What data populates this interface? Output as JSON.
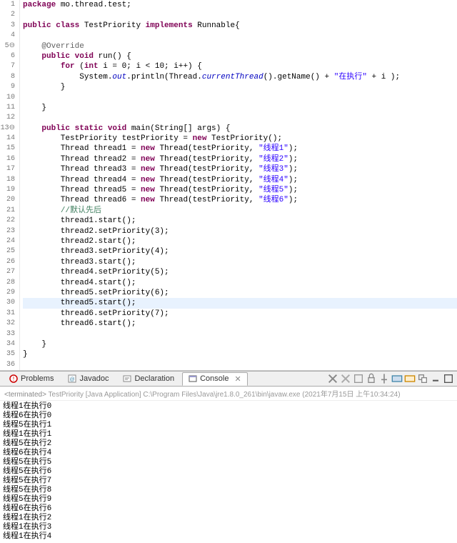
{
  "code": {
    "lines": [
      {
        "n": "1",
        "segs": [
          {
            "t": "package ",
            "c": "kw"
          },
          {
            "t": "mo.thread.test;"
          }
        ]
      },
      {
        "n": "2",
        "segs": []
      },
      {
        "n": "3",
        "segs": [
          {
            "t": "public class ",
            "c": "kw"
          },
          {
            "t": "TestPriority "
          },
          {
            "t": "implements ",
            "c": "kw"
          },
          {
            "t": "Runnable{"
          }
        ]
      },
      {
        "n": "4",
        "segs": []
      },
      {
        "n": "5⊖",
        "segs": [
          {
            "t": "    @Override",
            "c": "ann"
          }
        ]
      },
      {
        "n": "6",
        "segs": [
          {
            "t": "    "
          },
          {
            "t": "public void ",
            "c": "kw"
          },
          {
            "t": "run() {"
          }
        ]
      },
      {
        "n": "7",
        "segs": [
          {
            "t": "        "
          },
          {
            "t": "for ",
            "c": "kw"
          },
          {
            "t": "("
          },
          {
            "t": "int ",
            "c": "kw"
          },
          {
            "t": "i = 0; i < 10; i++) {"
          }
        ]
      },
      {
        "n": "8",
        "segs": [
          {
            "t": "            System."
          },
          {
            "t": "out",
            "c": "fld"
          },
          {
            "t": ".println(Thread."
          },
          {
            "t": "currentThread",
            "c": "fld"
          },
          {
            "t": "().getName() + "
          },
          {
            "t": "\"在执行\"",
            "c": "str"
          },
          {
            "t": " + i );"
          }
        ]
      },
      {
        "n": "9",
        "segs": [
          {
            "t": "        }"
          }
        ]
      },
      {
        "n": "10",
        "segs": []
      },
      {
        "n": "11",
        "segs": [
          {
            "t": "    }"
          }
        ]
      },
      {
        "n": "12",
        "segs": []
      },
      {
        "n": "13⊖",
        "segs": [
          {
            "t": "    "
          },
          {
            "t": "public static void ",
            "c": "kw"
          },
          {
            "t": "main(String[] args) {"
          }
        ]
      },
      {
        "n": "14",
        "segs": [
          {
            "t": "        TestPriority testPriority = "
          },
          {
            "t": "new ",
            "c": "kw"
          },
          {
            "t": "TestPriority();"
          }
        ]
      },
      {
        "n": "15",
        "segs": [
          {
            "t": "        Thread thread1 = "
          },
          {
            "t": "new ",
            "c": "kw"
          },
          {
            "t": "Thread(testPriority, "
          },
          {
            "t": "\"线程1\"",
            "c": "str"
          },
          {
            "t": ");"
          }
        ]
      },
      {
        "n": "16",
        "segs": [
          {
            "t": "        Thread thread2 = "
          },
          {
            "t": "new ",
            "c": "kw"
          },
          {
            "t": "Thread(testPriority, "
          },
          {
            "t": "\"线程2\"",
            "c": "str"
          },
          {
            "t": ");"
          }
        ]
      },
      {
        "n": "17",
        "segs": [
          {
            "t": "        Thread thread3 = "
          },
          {
            "t": "new ",
            "c": "kw"
          },
          {
            "t": "Thread(testPriority, "
          },
          {
            "t": "\"线程3\"",
            "c": "str"
          },
          {
            "t": ");"
          }
        ]
      },
      {
        "n": "18",
        "segs": [
          {
            "t": "        Thread thread4 = "
          },
          {
            "t": "new ",
            "c": "kw"
          },
          {
            "t": "Thread(testPriority, "
          },
          {
            "t": "\"线程4\"",
            "c": "str"
          },
          {
            "t": ");"
          }
        ]
      },
      {
        "n": "19",
        "segs": [
          {
            "t": "        Thread thread5 = "
          },
          {
            "t": "new ",
            "c": "kw"
          },
          {
            "t": "Thread(testPriority, "
          },
          {
            "t": "\"线程5\"",
            "c": "str"
          },
          {
            "t": ");"
          }
        ]
      },
      {
        "n": "20",
        "segs": [
          {
            "t": "        Thread thread6 = "
          },
          {
            "t": "new ",
            "c": "kw"
          },
          {
            "t": "Thread(testPriority, "
          },
          {
            "t": "\"线程6\"",
            "c": "str"
          },
          {
            "t": ");"
          }
        ]
      },
      {
        "n": "21",
        "segs": [
          {
            "t": "        "
          },
          {
            "t": "//默认先后",
            "c": "com"
          }
        ]
      },
      {
        "n": "22",
        "segs": [
          {
            "t": "        thread1.start();"
          }
        ]
      },
      {
        "n": "23",
        "segs": [
          {
            "t": "        thread2.setPriority(3);"
          }
        ]
      },
      {
        "n": "24",
        "segs": [
          {
            "t": "        thread2.start();"
          }
        ]
      },
      {
        "n": "25",
        "segs": [
          {
            "t": "        thread3.setPriority(4);"
          }
        ]
      },
      {
        "n": "26",
        "segs": [
          {
            "t": "        thread3.start();"
          }
        ]
      },
      {
        "n": "27",
        "segs": [
          {
            "t": "        thread4.setPriority(5);"
          }
        ]
      },
      {
        "n": "28",
        "segs": [
          {
            "t": "        thread4.start();"
          }
        ]
      },
      {
        "n": "29",
        "segs": [
          {
            "t": "        thread5.setPriority(6);"
          }
        ]
      },
      {
        "n": "30",
        "hl": true,
        "segs": [
          {
            "t": "        thread5.start();"
          }
        ]
      },
      {
        "n": "31",
        "segs": [
          {
            "t": "        thread6.setPriority(7);"
          }
        ]
      },
      {
        "n": "32",
        "segs": [
          {
            "t": "        thread6.start();"
          }
        ]
      },
      {
        "n": "33",
        "segs": []
      },
      {
        "n": "34",
        "segs": [
          {
            "t": "    }"
          }
        ]
      },
      {
        "n": "35",
        "segs": [
          {
            "t": "}"
          }
        ]
      },
      {
        "n": "36",
        "segs": []
      }
    ]
  },
  "tabs": {
    "problems": "Problems",
    "javadoc": "Javadoc",
    "declaration": "Declaration",
    "console": "Console"
  },
  "console": {
    "header_prefix": "<terminated>",
    "header_main": " TestPriority [Java Application] C:\\Program Files\\Java\\jre1.8.0_261\\bin\\javaw.exe (2021年7月15日 上午10:34:24)",
    "output": [
      "线程1在执行0",
      "线程6在执行0",
      "线程5在执行1",
      "线程1在执行1",
      "线程5在执行2",
      "线程6在执行4",
      "线程5在执行5",
      "线程5在执行6",
      "线程5在执行7",
      "线程5在执行8",
      "线程5在执行9",
      "线程6在执行6",
      "线程1在执行2",
      "线程1在执行3",
      "线程1在执行4"
    ]
  }
}
